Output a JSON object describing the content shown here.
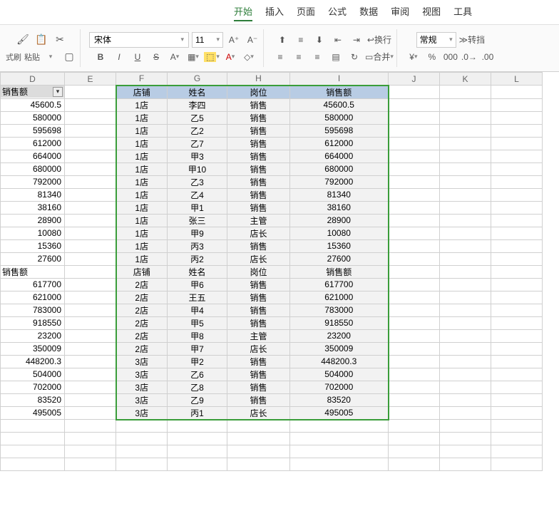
{
  "menu": {
    "items": [
      "开始",
      "插入",
      "页面",
      "公式",
      "数据",
      "审阅",
      "视图",
      "工具"
    ],
    "active_index": 0
  },
  "toolbar": {
    "format_painter": "式刷",
    "paste": "粘贴",
    "font_name": "宋体",
    "font_size": "11",
    "bold": "B",
    "italic": "I",
    "underline": "U",
    "strike": "S",
    "wrap": "换行",
    "merge": "合并",
    "number_format": "常规",
    "convert": "转挡"
  },
  "column_headers": [
    "D",
    "E",
    "F",
    "G",
    "H",
    "I",
    "J",
    "K",
    "L"
  ],
  "left_col_label": "销售额",
  "left_col_values": [
    "45600.5",
    "580000",
    "595698",
    "612000",
    "664000",
    "680000",
    "792000",
    "81340",
    "38160",
    "28900",
    "10080",
    "15360",
    "27600",
    "销售额",
    "617700",
    "621000",
    "783000",
    "918550",
    "23200",
    "350009",
    "448200.3",
    "504000",
    "702000",
    "83520",
    "495005"
  ],
  "green_table": {
    "headers": [
      "店铺",
      "姓名",
      "岗位",
      "销售额"
    ],
    "rows": [
      [
        "1店",
        "李四",
        "销售",
        "45600.5"
      ],
      [
        "1店",
        "乙5",
        "销售",
        "580000"
      ],
      [
        "1店",
        "乙2",
        "销售",
        "595698"
      ],
      [
        "1店",
        "乙7",
        "销售",
        "612000"
      ],
      [
        "1店",
        "甲3",
        "销售",
        "664000"
      ],
      [
        "1店",
        "甲10",
        "销售",
        "680000"
      ],
      [
        "1店",
        "乙3",
        "销售",
        "792000"
      ],
      [
        "1店",
        "乙4",
        "销售",
        "81340"
      ],
      [
        "1店",
        "甲1",
        "销售",
        "38160"
      ],
      [
        "1店",
        "张三",
        "主管",
        "28900"
      ],
      [
        "1店",
        "甲9",
        "店长",
        "10080"
      ],
      [
        "1店",
        "丙3",
        "销售",
        "15360"
      ],
      [
        "1店",
        "丙2",
        "店长",
        "27600"
      ],
      [
        "店铺",
        "姓名",
        "岗位",
        "销售额"
      ],
      [
        "2店",
        "甲6",
        "销售",
        "617700"
      ],
      [
        "2店",
        "王五",
        "销售",
        "621000"
      ],
      [
        "2店",
        "甲4",
        "销售",
        "783000"
      ],
      [
        "2店",
        "甲5",
        "销售",
        "918550"
      ],
      [
        "2店",
        "甲8",
        "主管",
        "23200"
      ],
      [
        "2店",
        "甲7",
        "店长",
        "350009"
      ],
      [
        "3店",
        "甲2",
        "销售",
        "448200.3"
      ],
      [
        "3店",
        "乙6",
        "销售",
        "504000"
      ],
      [
        "3店",
        "乙8",
        "销售",
        "702000"
      ],
      [
        "3店",
        "乙9",
        "销售",
        "83520"
      ],
      [
        "3店",
        "丙1",
        "店长",
        "495005"
      ]
    ]
  }
}
